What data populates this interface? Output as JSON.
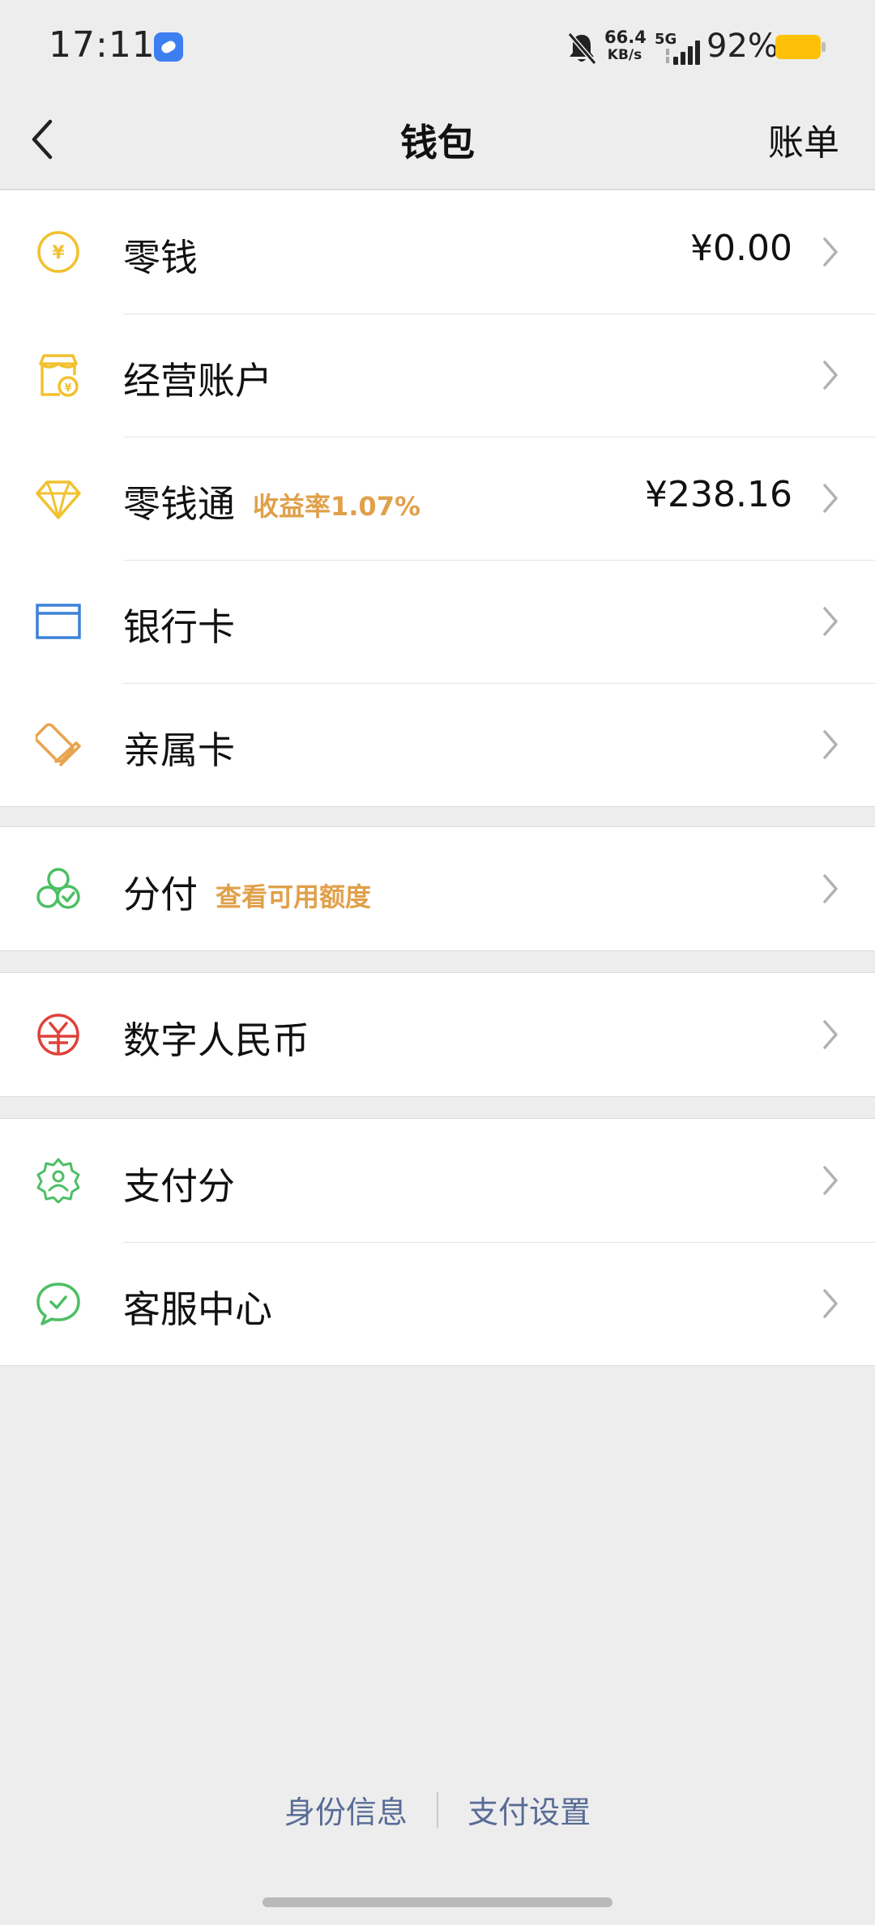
{
  "status_bar": {
    "time": "17:11",
    "net_speed_value": "66.4",
    "net_speed_unit": "KB/s",
    "network": "5G",
    "battery_pct": "92%"
  },
  "nav": {
    "title": "钱包",
    "bill_label": "账单"
  },
  "groups": {
    "main": {
      "change": {
        "label": "零钱",
        "amount": "¥0.00"
      },
      "business": {
        "label": "经营账户"
      },
      "lqt": {
        "label": "零钱通",
        "tag": "收益率1.07%",
        "amount": "¥238.16"
      },
      "bankcard": {
        "label": "银行卡"
      },
      "family": {
        "label": "亲属卡"
      }
    },
    "credit": {
      "fenfu": {
        "label": "分付",
        "tag": "查看可用额度"
      }
    },
    "digital": {
      "ecny": {
        "label": "数字人民币"
      }
    },
    "service": {
      "score": {
        "label": "支付分"
      },
      "support": {
        "label": "客服中心"
      }
    }
  },
  "footer": {
    "identity": "身份信息",
    "settings": "支付设置"
  },
  "colors": {
    "yellow": "#f2c12e",
    "orange": "#e8a44e",
    "blue": "#3b82d8",
    "green": "#4cbf64",
    "red": "#e0413a",
    "link": "#576b95"
  }
}
